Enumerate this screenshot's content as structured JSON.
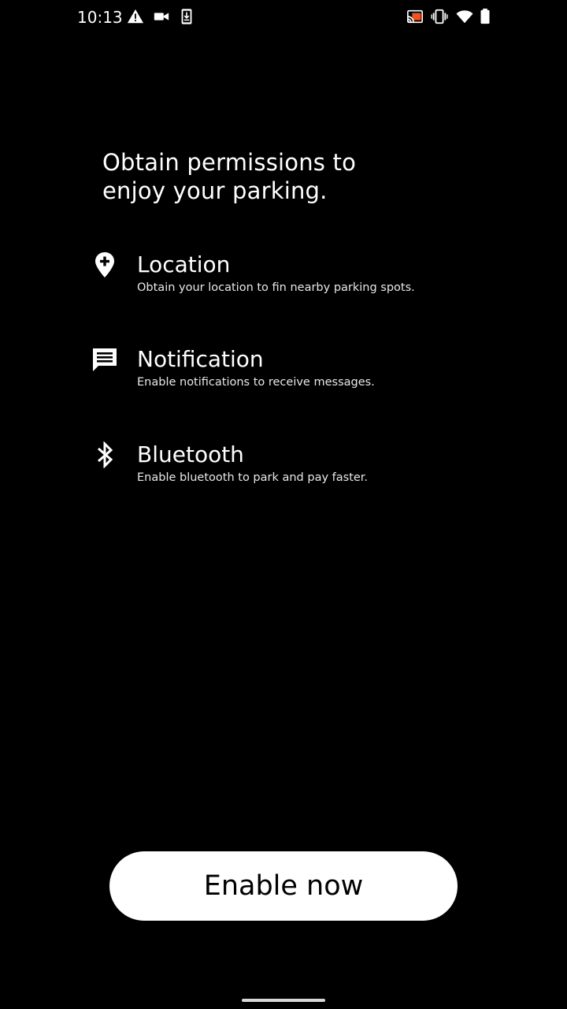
{
  "status_bar": {
    "time": "10:13",
    "left_icons": [
      "warning-icon",
      "video-camera-icon",
      "phone-download-icon"
    ],
    "right_icons": [
      "cast-icon",
      "vibrate-icon",
      "wifi-icon",
      "battery-icon"
    ]
  },
  "heading": {
    "line1": "Obtain permissions to",
    "line2": "enjoy your parking."
  },
  "permissions": [
    {
      "icon": "location-pin-icon",
      "title": "Location",
      "description": "Obtain your location to fin nearby parking spots."
    },
    {
      "icon": "message-icon",
      "title": "Notification",
      "description": "Enable notifications to receive messages."
    },
    {
      "icon": "bluetooth-icon",
      "title": "Bluetooth",
      "description": "Enable bluetooth to park and pay faster."
    }
  ],
  "button": {
    "label": "Enable now"
  },
  "colors": {
    "background": "#000000",
    "foreground": "#ffffff",
    "button_background": "#ffffff",
    "button_text": "#000000",
    "cast_accent": "#f4511e"
  }
}
